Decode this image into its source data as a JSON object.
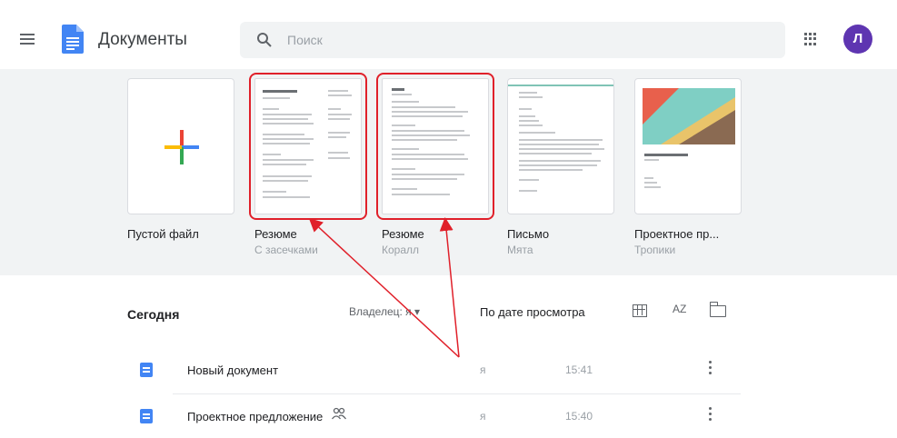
{
  "header": {
    "app_title": "Документы",
    "search_placeholder": "Поиск",
    "avatar_initial": "Л",
    "menu_icon": "hamburger-menu-icon",
    "apps_icon": "google-apps-grid-icon"
  },
  "templates": [
    {
      "name": "Пустой файл",
      "subtitle": "",
      "thumbnail": "blank-plus",
      "highlighted": false
    },
    {
      "name": "Резюме",
      "subtitle": "С засечками",
      "thumbnail": "resume-serif",
      "highlighted": true
    },
    {
      "name": "Резюме",
      "subtitle": "Коралл",
      "thumbnail": "resume-coral",
      "highlighted": true
    },
    {
      "name": "Письмо",
      "subtitle": "Мята",
      "thumbnail": "letter-mint",
      "highlighted": false
    },
    {
      "name": "Проектное пр...",
      "subtitle": "Тропики",
      "thumbnail": "project-tropic",
      "highlighted": false
    }
  ],
  "list": {
    "section_title": "Сегодня",
    "owner_filter": "Владелец: я ▾",
    "sort_label": "По дате просмотра",
    "sort_icon_text": "AZ",
    "rows": [
      {
        "name": "Новый документ",
        "shared": false,
        "owner": "я",
        "time": "15:41"
      },
      {
        "name": "Проектное предложение",
        "shared": true,
        "owner": "я",
        "time": "15:40"
      }
    ]
  },
  "colors": {
    "accent_blue": "#4285f4",
    "avatar_purple": "#5e35b1",
    "highlight_red": "#e0202a",
    "template_bg": "#f1f3f4"
  }
}
